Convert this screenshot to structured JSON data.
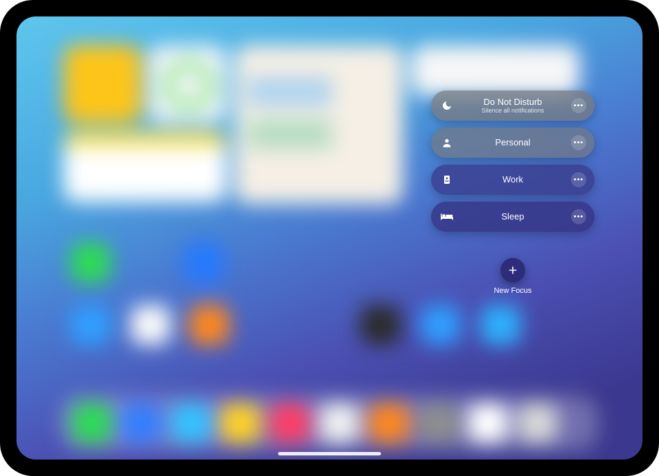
{
  "focus": {
    "items": [
      {
        "id": "do-not-disturb",
        "icon": "moon-icon",
        "title": "Do Not Disturb",
        "subtitle": "Silence all notifications",
        "pill_class": "dnd"
      },
      {
        "id": "personal",
        "icon": "person-icon",
        "title": "Personal",
        "subtitle": "",
        "pill_class": "personal"
      },
      {
        "id": "work",
        "icon": "badge-icon",
        "title": "Work",
        "subtitle": "",
        "pill_class": "work"
      },
      {
        "id": "sleep",
        "icon": "bed-icon",
        "title": "Sleep",
        "subtitle": "",
        "pill_class": "sleep"
      }
    ],
    "new_focus_label": "New Focus"
  },
  "colors": {
    "pill_gray": "#787880",
    "pill_indigo": "#3a3c8c",
    "text": "#ffffff"
  }
}
